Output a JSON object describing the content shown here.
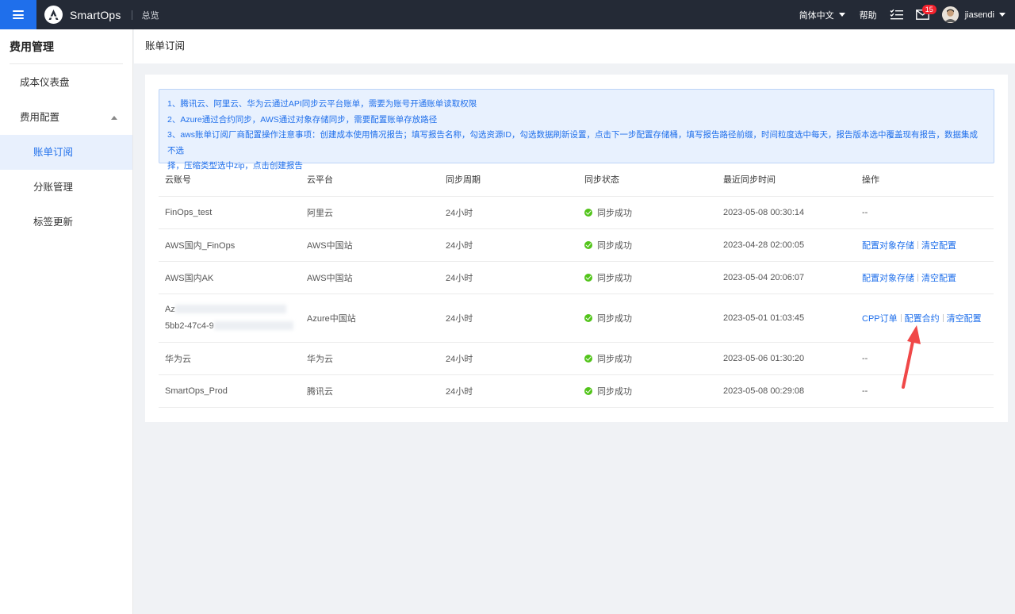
{
  "topbar": {
    "app_name": "SmartOps",
    "overview": "总览",
    "language": "简体中文",
    "help": "帮助",
    "mail_badge": "15",
    "user_name": "jiasendi"
  },
  "sidebar": {
    "title": "费用管理",
    "items": [
      {
        "label": "成本仪表盘"
      },
      {
        "label": "费用配置"
      }
    ],
    "sub_items": [
      {
        "label": "账单订阅"
      },
      {
        "label": "分账管理"
      },
      {
        "label": "标签更新"
      }
    ]
  },
  "page": {
    "title": "账单订阅",
    "notice": [
      "1、腾讯云、阿里云、华为云通过API同步云平台账单，需要为账号开通账单读取权限",
      "2、Azure通过合约同步，AWS通过对象存储同步，需要配置账单存放路径",
      "3、aws账单订阅厂商配置操作注意事项：创建成本使用情况报告；填写报告名称，勾选资源ID，勾选数据刷新设置，点击下一步配置存储桶，填写报告路径前缀，时间粒度选中每天，报告版本选中覆盖现有报告，数据集成不选",
      "择，压缩类型选中zip，点击创建报告"
    ]
  },
  "table": {
    "headers": [
      "云账号",
      "云平台",
      "同步周期",
      "同步状态",
      "最近同步时间",
      "操作"
    ],
    "rows": [
      {
        "account": "FinOps_test",
        "platform": "阿里云",
        "cycle": "24小时",
        "status": "同步成功",
        "time": "2023-05-08 00:30:14",
        "ops_text": "--"
      },
      {
        "account": "AWS国内_FinOps",
        "platform": "AWS中国站",
        "cycle": "24小时",
        "status": "同步成功",
        "time": "2023-04-28 02:00:05",
        "op1": "配置对象存储",
        "op2": "清空配置"
      },
      {
        "account": "AWS国内AK",
        "platform": "AWS中国站",
        "cycle": "24小时",
        "status": "同步成功",
        "time": "2023-05-04 20:06:07",
        "op1": "配置对象存储",
        "op2": "清空配置"
      },
      {
        "account_line1": "Az",
        "account_line2": "5bb2-47c4-9",
        "platform": "Azure中国站",
        "cycle": "24小时",
        "status": "同步成功",
        "time": "2023-05-01 01:03:45",
        "op1": "CPP订单",
        "op2": "配置合约",
        "op3": "清空配置"
      },
      {
        "account": "华为云",
        "platform": "华为云",
        "cycle": "24小时",
        "status": "同步成功",
        "time": "2023-05-06 01:30:20",
        "ops_text": "--"
      },
      {
        "account": "SmartOps_Prod",
        "platform": "腾讯云",
        "cycle": "24小时",
        "status": "同步成功",
        "time": "2023-05-08 00:29:08",
        "ops_text": "--"
      }
    ]
  },
  "colors": {
    "accent": "#1f6feb",
    "topbar": "#242a36",
    "success": "#52c41a",
    "arrow": "#f04848"
  }
}
